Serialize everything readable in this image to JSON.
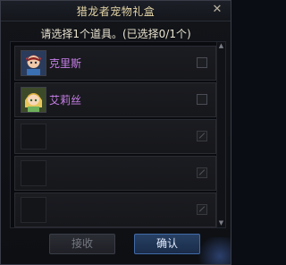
{
  "dialog": {
    "title": "猎龙者宠物礼盒",
    "prompt": "请选择1个道具。(已选择0/1个)"
  },
  "items": [
    {
      "name": "克里斯",
      "avatar_icon": "character-avatar-icon"
    },
    {
      "name": "艾莉丝",
      "avatar_icon": "character-avatar-icon"
    },
    {
      "name": ""
    },
    {
      "name": ""
    },
    {
      "name": ""
    }
  ],
  "buttons": {
    "receive": "接收",
    "confirm": "确认"
  },
  "colors": {
    "title": "#e6d7a8",
    "item_name": "#c77fe8",
    "confirm_bg": "#274064"
  }
}
